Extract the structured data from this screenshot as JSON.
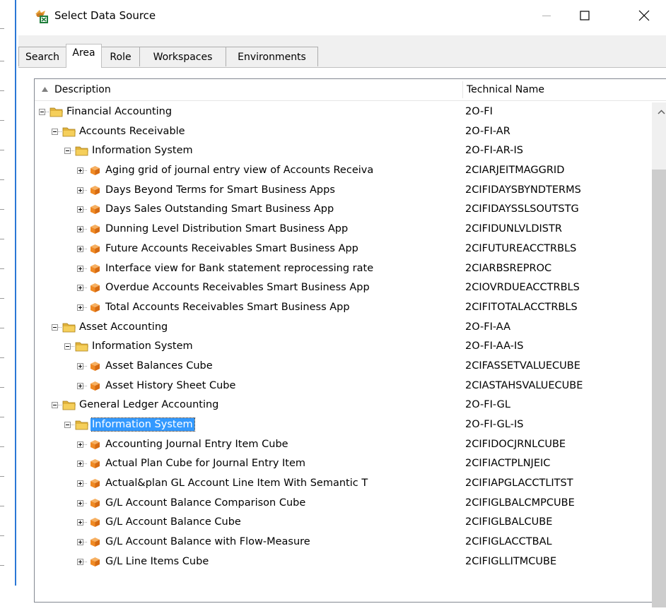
{
  "window": {
    "title": "Select Data Source"
  },
  "tabs": [
    {
      "label": "Search"
    },
    {
      "label": "Area"
    },
    {
      "label": "Role"
    },
    {
      "label": "Workspaces"
    },
    {
      "label": "Environments"
    }
  ],
  "active_tab": "Area",
  "columns": {
    "description": "Description",
    "technical_name": "Technical Name",
    "sort": "ascending"
  },
  "rows": [
    {
      "level": 0,
      "type": "folder",
      "expanded": true,
      "description": "Financial Accounting",
      "technical_name": "2O-FI"
    },
    {
      "level": 1,
      "type": "folder",
      "expanded": true,
      "description": "Accounts Receivable",
      "technical_name": "2O-FI-AR"
    },
    {
      "level": 2,
      "type": "folder",
      "expanded": true,
      "description": "Information System",
      "technical_name": "2O-FI-AR-IS"
    },
    {
      "level": 3,
      "type": "cube",
      "expanded": false,
      "description": "Aging grid of journal entry view of Accounts Receiva",
      "technical_name": "2CIARJEITMAGGRID"
    },
    {
      "level": 3,
      "type": "cube",
      "expanded": false,
      "description": "Days Beyond Terms for Smart Business Apps",
      "technical_name": "2CIFIDAYSBYNDTERMS"
    },
    {
      "level": 3,
      "type": "cube",
      "expanded": false,
      "description": "Days Sales Outstanding Smart Business App",
      "technical_name": "2CIFIDAYSSLSOUTSTG"
    },
    {
      "level": 3,
      "type": "cube",
      "expanded": false,
      "description": "Dunning Level Distribution Smart Business App",
      "technical_name": "2CIFIDUNLVLDISTR"
    },
    {
      "level": 3,
      "type": "cube",
      "expanded": false,
      "description": "Future Accounts Receivables Smart Business App",
      "technical_name": "2CIFUTUREACCTRBLS"
    },
    {
      "level": 3,
      "type": "cube",
      "expanded": false,
      "description": "Interface view for Bank statement reprocessing rate",
      "technical_name": "2CIARBSREPROC"
    },
    {
      "level": 3,
      "type": "cube",
      "expanded": false,
      "description": "Overdue Accounts Receivables Smart Business App",
      "technical_name": "2CIOVRDUEACCTRBLS"
    },
    {
      "level": 3,
      "type": "cube",
      "expanded": false,
      "description": "Total Accounts Receivables Smart Business App",
      "technical_name": "2CIFITOTALACCTRBLS"
    },
    {
      "level": 1,
      "type": "folder",
      "expanded": true,
      "description": "Asset Accounting",
      "technical_name": "2O-FI-AA"
    },
    {
      "level": 2,
      "type": "folder",
      "expanded": true,
      "description": "Information System",
      "technical_name": "2O-FI-AA-IS"
    },
    {
      "level": 3,
      "type": "cube",
      "expanded": false,
      "description": "Asset Balances Cube",
      "technical_name": "2CIFASSETVALUECUBE"
    },
    {
      "level": 3,
      "type": "cube",
      "expanded": false,
      "description": "Asset History Sheet Cube",
      "technical_name": "2CIASTAHSVALUECUBE"
    },
    {
      "level": 1,
      "type": "folder",
      "expanded": true,
      "description": "General Ledger Accounting",
      "technical_name": "2O-FI-GL"
    },
    {
      "level": 2,
      "type": "folder",
      "expanded": true,
      "selected": true,
      "description": "Information System",
      "technical_name": "2O-FI-GL-IS"
    },
    {
      "level": 3,
      "type": "cube",
      "expanded": false,
      "description": "Accounting Journal Entry Item Cube",
      "technical_name": "2CIFIDOCJRNLCUBE"
    },
    {
      "level": 3,
      "type": "cube",
      "expanded": false,
      "description": "Actual Plan Cube for Journal Entry Item",
      "technical_name": "2CIFIACTPLNJEIC"
    },
    {
      "level": 3,
      "type": "cube",
      "expanded": false,
      "description": "Actual&plan GL Account Line Item With Semantic T",
      "technical_name": "2CIFIAPGLACCTLITST"
    },
    {
      "level": 3,
      "type": "cube",
      "expanded": false,
      "description": "G/L Account Balance Comparison Cube",
      "technical_name": "2CIFIGLBALCMPCUBE"
    },
    {
      "level": 3,
      "type": "cube",
      "expanded": false,
      "description": "G/L Account Balance Cube",
      "technical_name": "2CIFIGLBALCUBE"
    },
    {
      "level": 3,
      "type": "cube",
      "expanded": false,
      "description": "G/L Account Balance with Flow-Measure",
      "technical_name": "2CIFIGLACCTBAL"
    },
    {
      "level": 3,
      "type": "cube",
      "expanded": false,
      "description": "G/L Line Items Cube",
      "technical_name": "2CIFIGLLITMCUBE"
    }
  ],
  "colors": {
    "accent": "#2b78d6",
    "selection": "#3399ff",
    "folder": "#f5cf5b",
    "cube": "#f08a24"
  }
}
